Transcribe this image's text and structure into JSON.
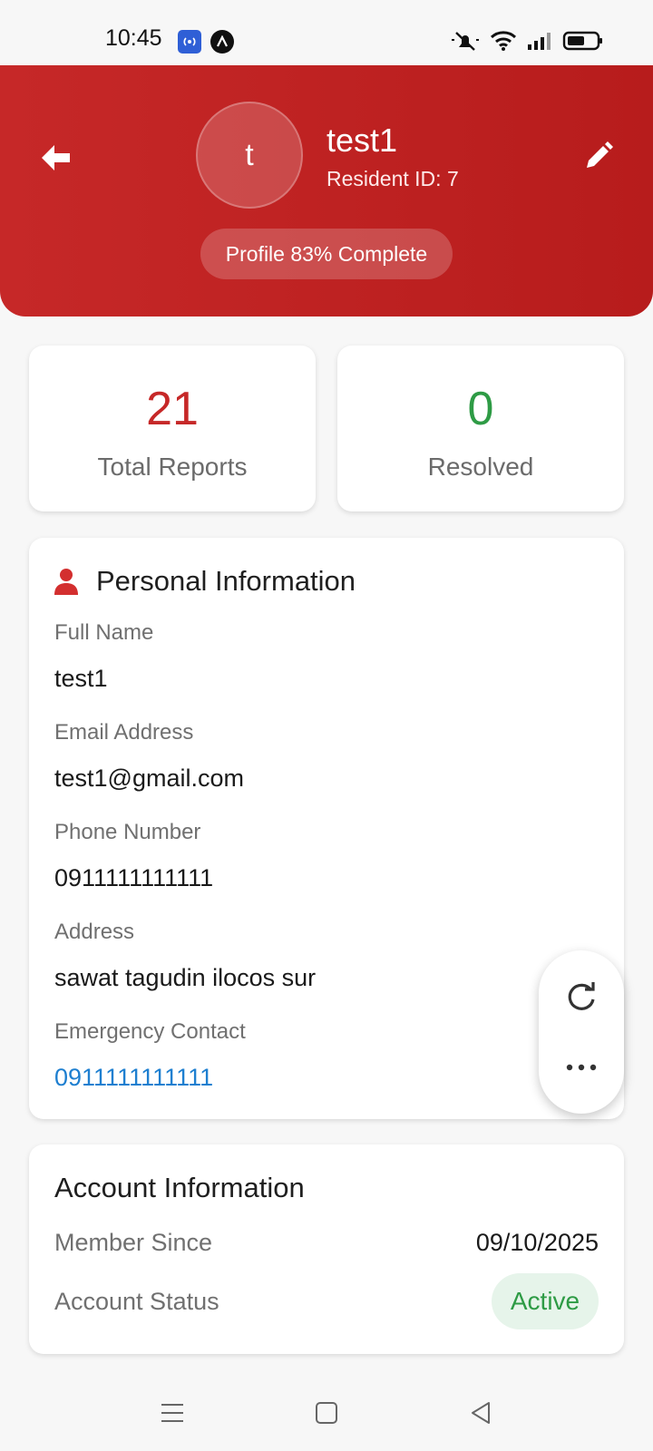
{
  "status_bar": {
    "time": "10:45",
    "icons": [
      "radio-broadcast-icon",
      "a-logo-icon",
      "mute-icon",
      "wifi-icon",
      "signal-icon",
      "battery-icon"
    ]
  },
  "header": {
    "avatar_initial": "t",
    "user_name": "test1",
    "resident_id": "Resident ID: 7",
    "profile_completion": "Profile 83% Complete",
    "back_icon": "arrow-left-icon",
    "edit_icon": "pencil-icon"
  },
  "stats": {
    "total_reports": {
      "value": "21",
      "label": "Total Reports",
      "color": "#c62828"
    },
    "resolved": {
      "value": "0",
      "label": "Resolved",
      "color": "#2e9b45"
    }
  },
  "personal_info": {
    "title": "Personal Information",
    "icon": "person-icon",
    "fields": [
      {
        "label": "Full Name",
        "value": "test1"
      },
      {
        "label": "Email Address",
        "value": "test1@gmail.com"
      },
      {
        "label": "Phone Number",
        "value": "0911111111111"
      },
      {
        "label": "Address",
        "value": "sawat tagudin ilocos sur"
      },
      {
        "label": "Emergency Contact",
        "value": "0911111111111"
      }
    ]
  },
  "fab": {
    "refresh_icon": "refresh-icon",
    "more_icon": "more-horizontal-icon"
  },
  "account_info": {
    "title": "Account Information",
    "member_since_label": "Member Since",
    "member_since_value": "09/10/2025",
    "status_label": "Account Status",
    "status_value": "Active"
  },
  "nav": {
    "icons": [
      "menu-icon",
      "home-square-icon",
      "back-triangle-icon"
    ]
  },
  "colors": {
    "brand_red": "#c62828",
    "success_green": "#2e9b45",
    "link_blue": "#1e7fd0"
  }
}
